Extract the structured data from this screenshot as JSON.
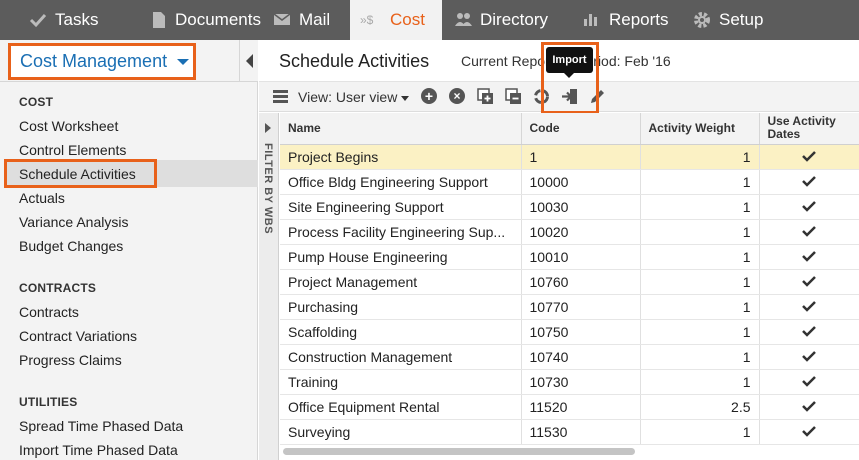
{
  "nav": {
    "tabs": [
      {
        "label": "Tasks",
        "icon": "check-icon"
      },
      {
        "label": "Documents",
        "icon": "document-icon"
      },
      {
        "label": "Mail",
        "icon": "mail-icon"
      },
      {
        "label": "Cost",
        "icon": "cost-icon",
        "active": true
      },
      {
        "label": "Directory",
        "icon": "directory-icon"
      },
      {
        "label": "Reports",
        "icon": "reports-icon"
      },
      {
        "label": "Setup",
        "icon": "gear-icon"
      }
    ]
  },
  "sidebar": {
    "module": "Cost Management",
    "sections": [
      {
        "title": "COST",
        "items": [
          "Cost Worksheet",
          "Control Elements",
          "Schedule Activities",
          "Actuals",
          "Variance Analysis",
          "Budget Changes"
        ]
      },
      {
        "title": "CONTRACTS",
        "items": [
          "Contracts",
          "Contract Variations",
          "Progress Claims"
        ]
      },
      {
        "title": "UTILITIES",
        "items": [
          "Spread Time Phased Data",
          "Import Time Phased Data"
        ]
      }
    ],
    "selected": "Schedule Activities"
  },
  "main": {
    "title": "Schedule Activities",
    "period": "Current Reporting Period: Feb '16"
  },
  "toolbar": {
    "view_label": "View: User view",
    "tooltip": "Import"
  },
  "filter_label": "FILTER BY WBS",
  "table": {
    "columns": [
      "Name",
      "Code",
      "Activity Weight",
      "Use Activity Dates"
    ],
    "rows": [
      {
        "name": "Project Begins",
        "code": "1",
        "weight": "1",
        "use_dates": true
      },
      {
        "name": "Office Bldg Engineering Support",
        "code": "10000",
        "weight": "1",
        "use_dates": true
      },
      {
        "name": "Site Engineering Support",
        "code": "10030",
        "weight": "1",
        "use_dates": true
      },
      {
        "name": "Process Facility Engineering Sup...",
        "code": "10020",
        "weight": "1",
        "use_dates": true
      },
      {
        "name": "Pump House Engineering",
        "code": "10010",
        "weight": "1",
        "use_dates": true
      },
      {
        "name": "Project Management",
        "code": "10760",
        "weight": "1",
        "use_dates": true
      },
      {
        "name": "Purchasing",
        "code": "10770",
        "weight": "1",
        "use_dates": true
      },
      {
        "name": "Scaffolding",
        "code": "10750",
        "weight": "1",
        "use_dates": true
      },
      {
        "name": "Construction Management",
        "code": "10740",
        "weight": "1",
        "use_dates": true
      },
      {
        "name": "Training",
        "code": "10730",
        "weight": "1",
        "use_dates": true
      },
      {
        "name": "Office Equipment Rental",
        "code": "11520",
        "weight": "2.5",
        "use_dates": true
      },
      {
        "name": "Surveying",
        "code": "11530",
        "weight": "1",
        "use_dates": true
      }
    ]
  },
  "colors": {
    "accent": "#e8611a",
    "link": "#1a6fb4",
    "nav_bg": "#5c5c5c",
    "highlight_row": "#fbf1c4"
  }
}
